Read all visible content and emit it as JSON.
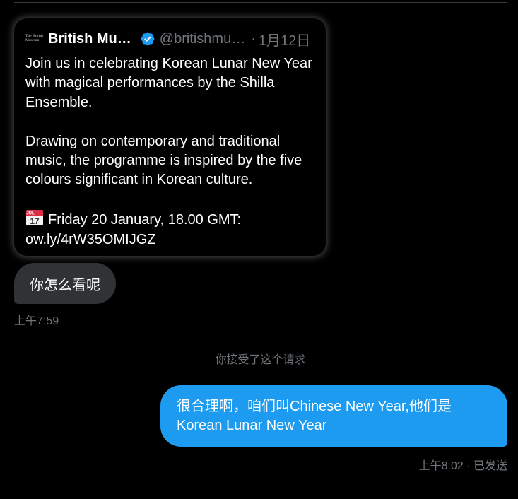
{
  "quote": {
    "avatar_line1": "The British",
    "avatar_line2": "Museum",
    "name": "British Mu…",
    "handle": "@britishmu…",
    "separator": "·",
    "date": "1月12日",
    "paragraph1": "Join us in celebrating Korean Lunar New Year with magical performances by the Shilla Ensemble.",
    "paragraph2": "Drawing on contemporary and traditional music, the programme is inspired by the five colours significant in Korean culture.",
    "event_line": "Friday 20 January, 18.00 GMT:",
    "link": "ow.ly/4rW35OMIJGZ",
    "calendar_month": "JUL",
    "calendar_day": "17"
  },
  "incoming": {
    "text": "你怎么看呢",
    "time": "上午7:59"
  },
  "system": {
    "text": "你接受了这个请求"
  },
  "outgoing": {
    "line1": "很合理啊，咱们叫Chinese New Year,他们是",
    "line2": "Korean Lunar New Year",
    "time": "上午8:02",
    "separator": "·",
    "status": "已发送"
  },
  "colors": {
    "outgoing_bubble": "#1d9bf0",
    "incoming_bubble": "#2f3336",
    "muted_text": "#71767b",
    "verified_badge": "#1d9bf0"
  },
  "icons": {
    "verified": "verified-badge-icon",
    "calendar": "calendar-emoji-icon"
  }
}
